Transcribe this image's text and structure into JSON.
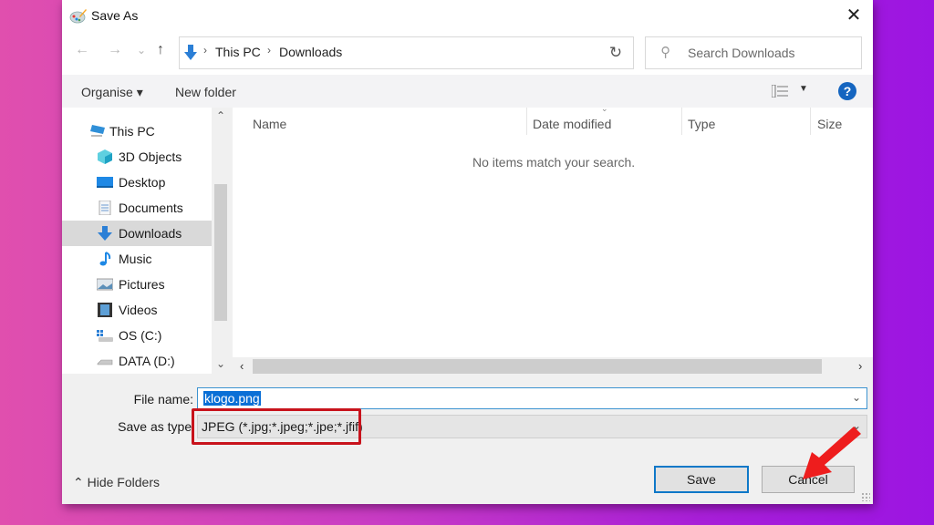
{
  "dialog": {
    "title": "Save As",
    "close_glyph": "✕"
  },
  "nav": {
    "back_glyph": "←",
    "forward_glyph": "→",
    "recent_glyph": "⌄",
    "up_glyph": "↑",
    "breadcrumb": [
      "This PC",
      "Downloads"
    ],
    "separator_glyph": "›",
    "dropdown_glyph": "⌄",
    "refresh_glyph": "↻",
    "search_placeholder": "Search Downloads",
    "search_glyph": "⚲"
  },
  "toolbar": {
    "organise_label": "Organise ▾",
    "new_folder_label": "New folder",
    "view_dropdown_glyph": "▼",
    "help_glyph": "?"
  },
  "sidebar": {
    "items": [
      {
        "label": "This PC",
        "icon": "computer-icon"
      },
      {
        "label": "3D Objects",
        "icon": "cube-icon"
      },
      {
        "label": "Desktop",
        "icon": "desktop-icon"
      },
      {
        "label": "Documents",
        "icon": "document-icon"
      },
      {
        "label": "Downloads",
        "icon": "download-icon",
        "selected": true
      },
      {
        "label": "Music",
        "icon": "music-icon"
      },
      {
        "label": "Pictures",
        "icon": "picture-icon"
      },
      {
        "label": "Videos",
        "icon": "video-icon"
      },
      {
        "label": "OS (C:)",
        "icon": "drive-icon"
      },
      {
        "label": "DATA (D:)",
        "icon": "drive-icon"
      }
    ],
    "scroll_up_glyph": "⌃",
    "scroll_down_glyph": "⌄"
  },
  "files": {
    "columns": [
      "Name",
      "Date modified",
      "Type",
      "Size"
    ],
    "sort_glyph": "⌄",
    "empty_message": "No items match your search.",
    "scroll_left_glyph": "‹",
    "scroll_right_glyph": "›"
  },
  "form": {
    "file_name_label": "File name:",
    "file_name_value": "klogo.png",
    "save_type_label": "Save as type:",
    "save_type_value": "JPEG (*.jpg;*.jpeg;*.jpe;*.jfif)",
    "dropdown_glyph": "⌄"
  },
  "footer": {
    "hide_folders_label": "⌃  Hide Folders",
    "save_label": "Save",
    "cancel_label": "Cancel"
  },
  "colors": {
    "accent": "#0e78c8",
    "highlight_box": "#c8131c",
    "arrow": "#ee1d1d",
    "help": "#1565c0"
  }
}
